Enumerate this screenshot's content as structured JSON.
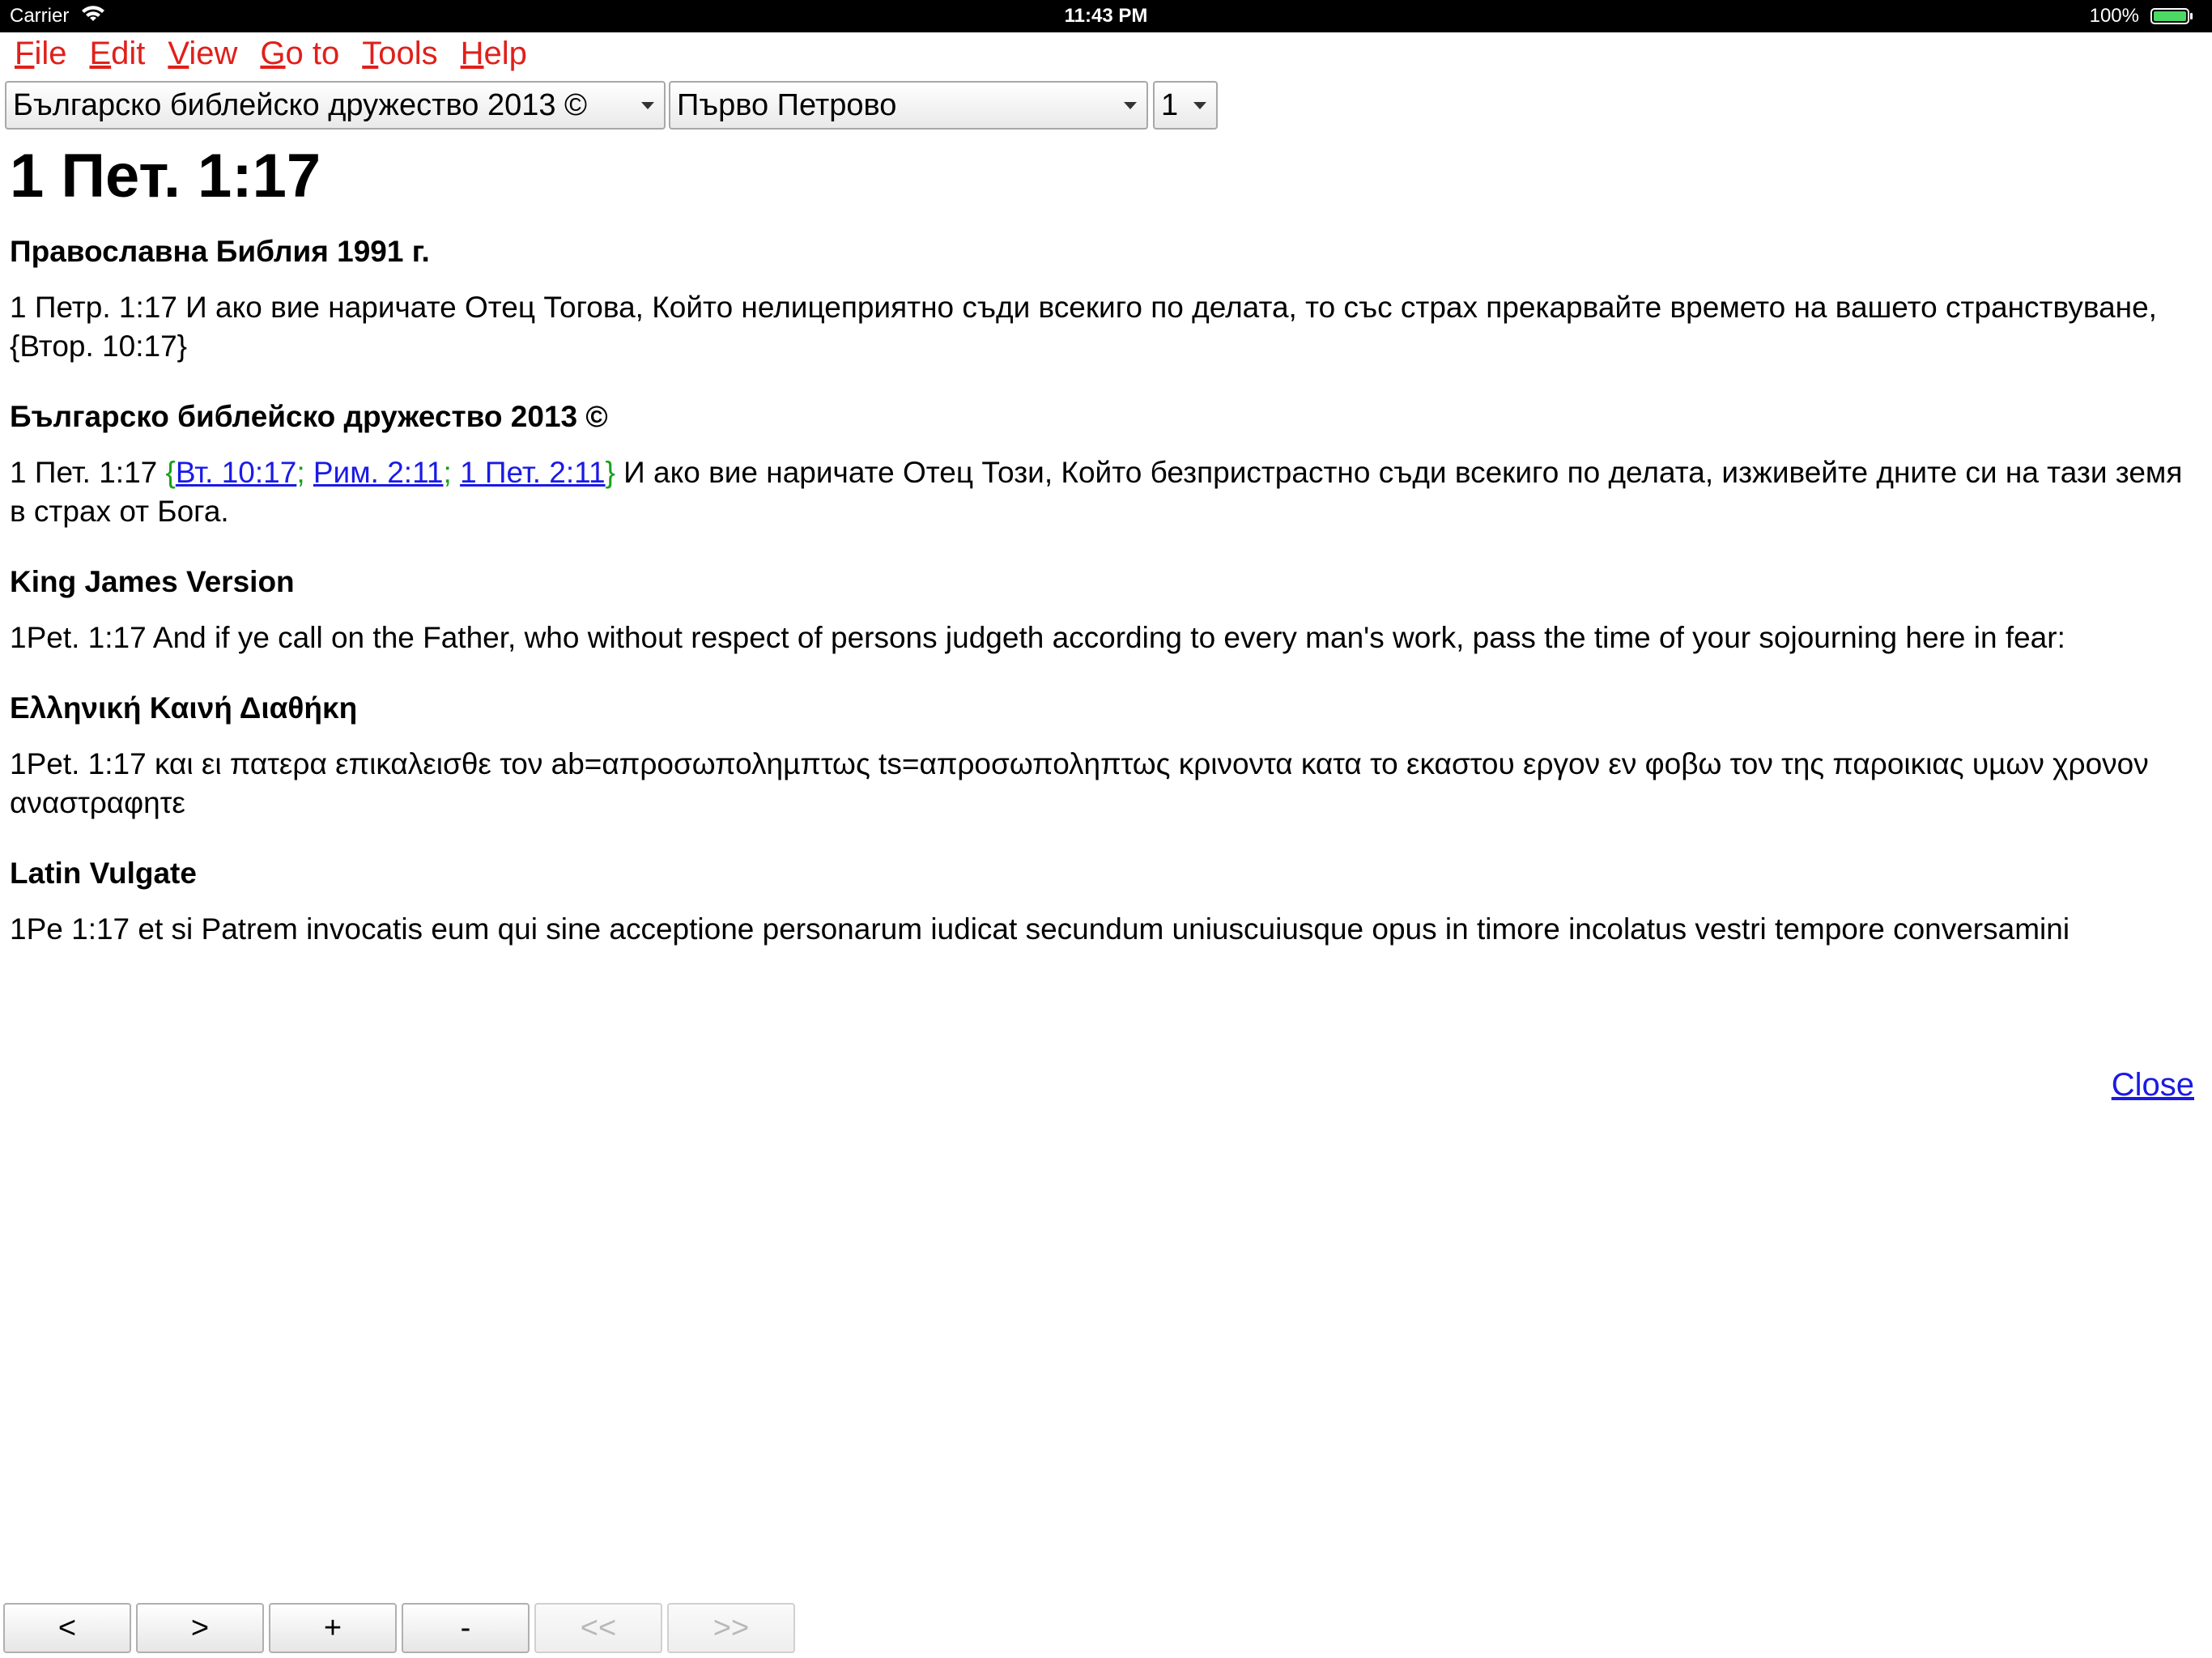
{
  "status_bar": {
    "carrier": "Carrier",
    "time": "11:43 PM",
    "battery_percent": "100%",
    "battery_color": "#4cd964"
  },
  "menu": {
    "file": {
      "accel": "F",
      "rest": "ile"
    },
    "edit": {
      "accel": "E",
      "rest": "dit"
    },
    "view": {
      "accel": "V",
      "rest": "iew"
    },
    "goto": {
      "accel": "G",
      "rest": "o to"
    },
    "tools": {
      "accel": "T",
      "rest": "ools"
    },
    "help": {
      "accel": "H",
      "rest": "elp"
    }
  },
  "selectors": {
    "translation": "Българско библейско дружество 2013 ©",
    "book": "Първо Петрово",
    "chapter": "1"
  },
  "page_title": "1 Пет. 1:17",
  "sections": {
    "s1": {
      "title": "Православна Библия 1991 г.",
      "text": "1 Петр. 1:17 И ако вие наричате Отец Тогова, Който нелицеприятно съди всекиго по делата, то със страх прекарвайте времето на вашето странствуване, {Втор. 10:17}"
    },
    "s2": {
      "title": "Българско библейско дружество 2013 ©",
      "prefix": "1 Пет. 1:17 ",
      "brace_open": "{",
      "ref1": "Вт. 10:17",
      "sep1": "; ",
      "ref2": "Рим. 2:11",
      "sep2": "; ",
      "ref3": "1 Пет. 2:11",
      "brace_close": "}",
      "suffix": " И ако вие наричате Отец Този, Който безпристрастно съди всекиго по делата, изживейте дните си на тази земя в страх от Бога."
    },
    "s3": {
      "title": "King James Version",
      "text": "1Pet. 1:17 And if ye call on the Father, who without respect of persons judgeth according to every man's work, pass the time of your sojourning here in fear:"
    },
    "s4": {
      "title": "Ελληνική Καινή Διαθήκη",
      "text": "1Pet. 1:17 και ει πατερα επικαλεισθε τον ab=απροσωποληµπτως ts=απροσωποληπτως κρινοντα κατα το εκαστου εργον εν φοβω τον της παροικιας υµων χρονον αναστραφητε"
    },
    "s5": {
      "title": "Latin Vulgate",
      "text": "1Pe 1:17 et si Patrem invocatis eum qui sine acceptione personarum iudicat secundum uniuscuiusque opus in timore incolatus vestri tempore conversamini"
    }
  },
  "close_label": "Close",
  "buttons": {
    "prev": "<",
    "next": ">",
    "zoom_in": "+",
    "zoom_out": "-",
    "first": "<<",
    "last": ">>"
  },
  "colors": {
    "menu_text": "#e0201a",
    "link": "#1a1ae6",
    "xref_brace": "#19a019"
  }
}
